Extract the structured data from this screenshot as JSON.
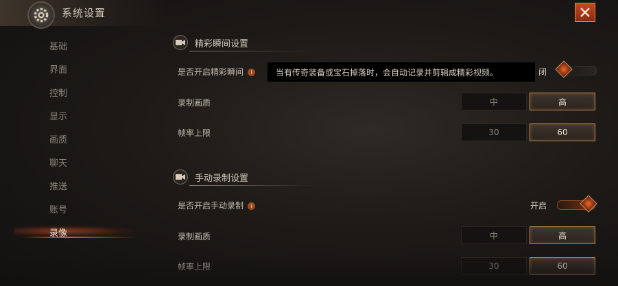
{
  "title": "系统设置",
  "sidebar": {
    "items": [
      {
        "label": "基础"
      },
      {
        "label": "界面"
      },
      {
        "label": "控制"
      },
      {
        "label": "显示"
      },
      {
        "label": "画质"
      },
      {
        "label": "聊天"
      },
      {
        "label": "推送"
      },
      {
        "label": "账号"
      },
      {
        "label": "录像"
      }
    ],
    "active": "录像"
  },
  "highlight_section": {
    "title": "精彩瞬间设置",
    "enable_label": "是否开启精彩瞬间",
    "toggle_text": "闭",
    "toggle_on": false,
    "quality_label": "录制画质",
    "quality_options": [
      "中",
      "高"
    ],
    "quality_selected": "高",
    "fps_label": "帧率上限",
    "fps_options": [
      "30",
      "60"
    ],
    "fps_selected": "60"
  },
  "tooltip": "当有传奇装备或宝石掉落时，会自动记录并剪辑成精彩视频。",
  "manual_section": {
    "title": "手动录制设置",
    "enable_label": "是否开启手动录制",
    "toggle_text": "开启",
    "toggle_on": true,
    "quality_label": "录制画质",
    "quality_options": [
      "中",
      "高"
    ],
    "quality_selected": "高",
    "fps_label": "帧率上限",
    "fps_options": [
      "30",
      "60"
    ],
    "fps_selected": "60"
  },
  "colors": {
    "accent": "#d9622a",
    "selected_border": "#b9864f"
  },
  "icons": {
    "title": "gear-icon",
    "close": "close-icon",
    "section": "camera-icon",
    "info": "info-icon"
  }
}
